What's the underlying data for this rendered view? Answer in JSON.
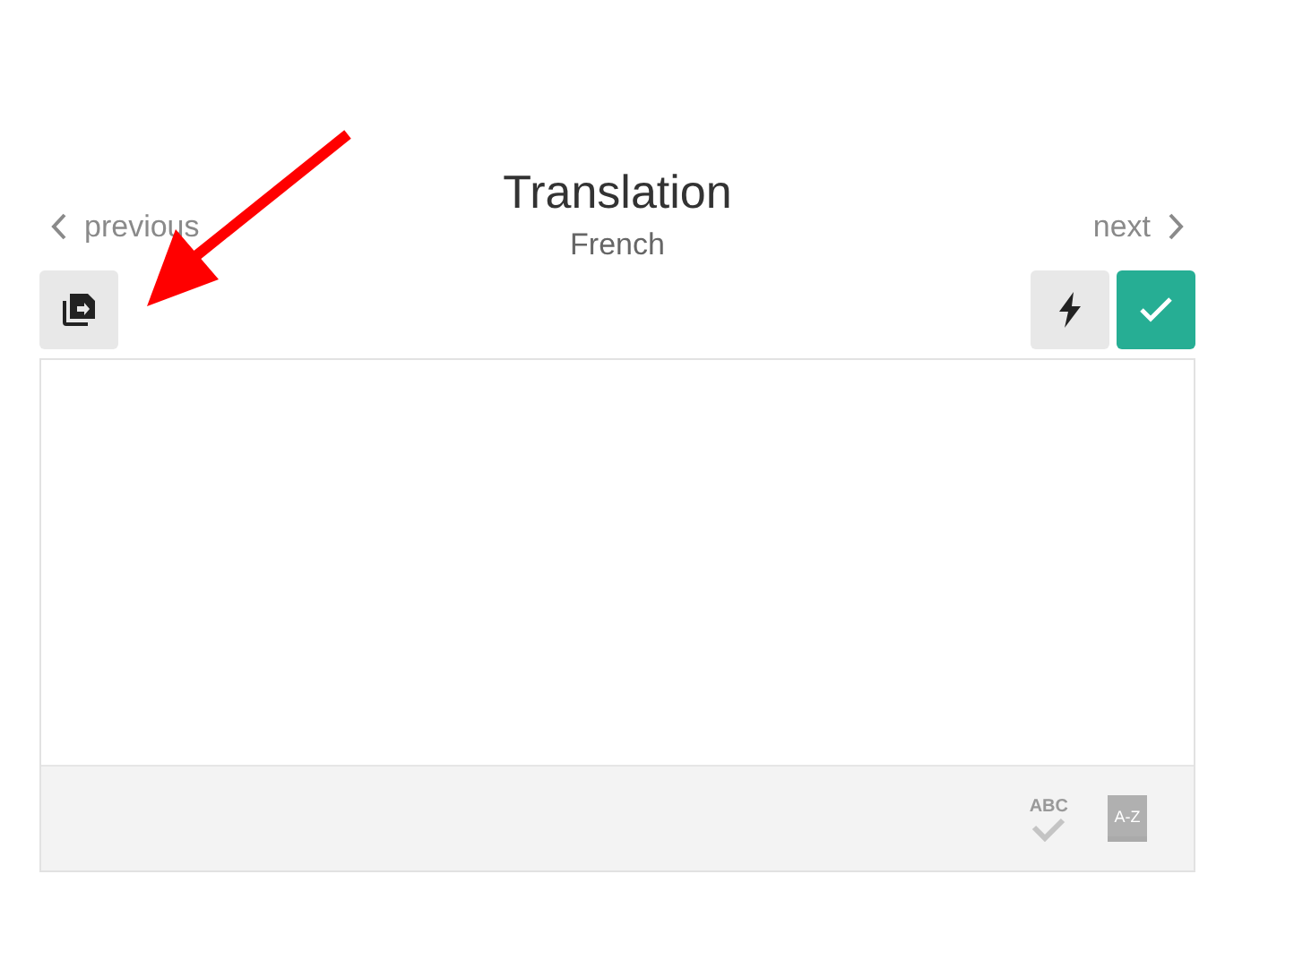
{
  "header": {
    "previous": "previous",
    "title": "Translation",
    "subtitle": "French",
    "next": "next"
  },
  "footer": {
    "spellcheck_label": "ABC",
    "dictionary_label": "A-Z"
  },
  "annotation": {
    "kind": "arrow"
  }
}
